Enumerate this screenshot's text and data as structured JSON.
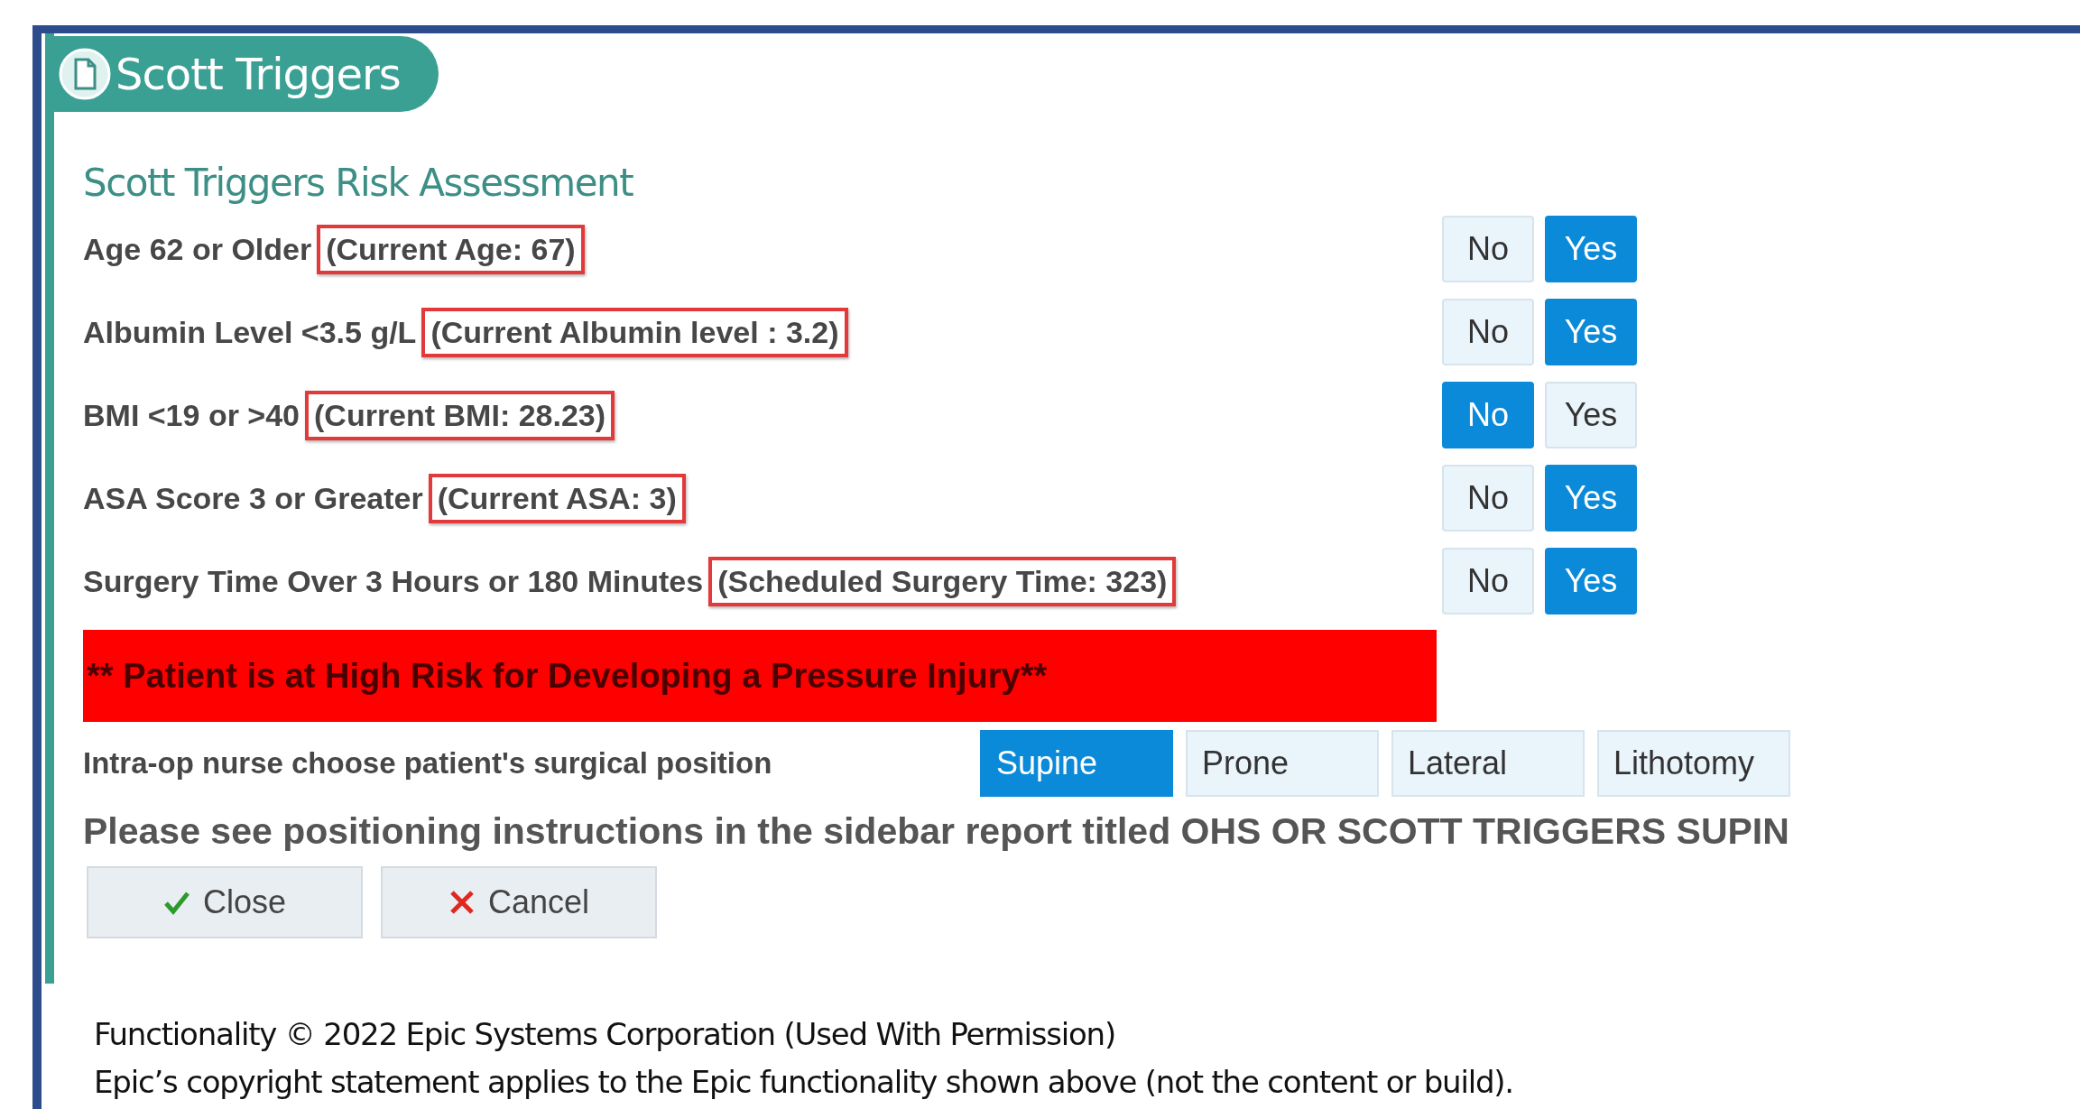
{
  "panel": {
    "title": "Scott Triggers"
  },
  "section": {
    "heading": "Scott Triggers Risk Assessment"
  },
  "criteria": [
    {
      "label": "Age 62 or Older",
      "note": "(Current Age: 67)",
      "options": [
        {
          "label": "No",
          "selected": false
        },
        {
          "label": "Yes",
          "selected": true
        }
      ]
    },
    {
      "label": "Albumin Level <3.5 g/L",
      "note": "(Current Albumin level : 3.2)",
      "options": [
        {
          "label": "No",
          "selected": false
        },
        {
          "label": "Yes",
          "selected": true
        }
      ]
    },
    {
      "label": "BMI <19 or >40",
      "note": "(Current BMI: 28.23)",
      "options": [
        {
          "label": "No",
          "selected": true
        },
        {
          "label": "Yes",
          "selected": false
        }
      ]
    },
    {
      "label": "ASA Score 3 or Greater",
      "note": "(Current ASA: 3)",
      "options": [
        {
          "label": "No",
          "selected": false
        },
        {
          "label": "Yes",
          "selected": true
        }
      ]
    },
    {
      "label": "Surgery Time Over 3 Hours or 180 Minutes",
      "note": "(Scheduled Surgery Time: 323)",
      "options": [
        {
          "label": "No",
          "selected": false
        },
        {
          "label": "Yes",
          "selected": true
        }
      ]
    }
  ],
  "alert": "** Patient is at High Risk for Developing a Pressure Injury**",
  "position": {
    "label": "Intra-op nurse choose patient's surgical position",
    "options": [
      {
        "label": "Supine",
        "selected": true
      },
      {
        "label": "Prone",
        "selected": false
      },
      {
        "label": "Lateral",
        "selected": false
      },
      {
        "label": "Lithotomy",
        "selected": false
      }
    ]
  },
  "instruction": "Please see positioning instructions in the sidebar report titled OHS OR SCOTT TRIGGERS SUPIN",
  "buttons": [
    {
      "label": "Close",
      "kind": "confirm"
    },
    {
      "label": "Cancel",
      "kind": "cancel"
    }
  ],
  "footer": [
    "Functionality © 2022 Epic Systems Corporation (Used With Permission)",
    "Epic’s copyright statement applies to the Epic functionality shown above (not the content or build)."
  ]
}
